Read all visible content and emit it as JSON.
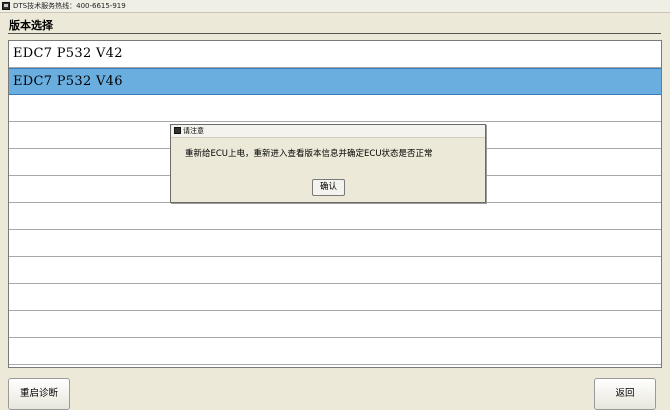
{
  "window": {
    "title": "DTS技术服务热线：400-6615-919"
  },
  "section": {
    "title": "版本选择"
  },
  "version_list": {
    "items": [
      {
        "label": "EDC7 P532 V42",
        "selected": false
      },
      {
        "label": "EDC7 P532 V46",
        "selected": true
      },
      {
        "label": "",
        "selected": false
      },
      {
        "label": "",
        "selected": false
      },
      {
        "label": "",
        "selected": false
      },
      {
        "label": "",
        "selected": false
      },
      {
        "label": "",
        "selected": false
      },
      {
        "label": "",
        "selected": false
      },
      {
        "label": "",
        "selected": false
      },
      {
        "label": "",
        "selected": false
      },
      {
        "label": "",
        "selected": false
      },
      {
        "label": "",
        "selected": false
      }
    ]
  },
  "dialog": {
    "title": "请注意",
    "message": "重新给ECU上电，重新进入查看版本信息并确定ECU状态是否正常",
    "ok_label": "确认"
  },
  "footer": {
    "restart_label": "重启诊断",
    "back_label": "返回"
  },
  "colors": {
    "selected_row": "#6aaee0",
    "window_bg": "#ece9d8"
  }
}
